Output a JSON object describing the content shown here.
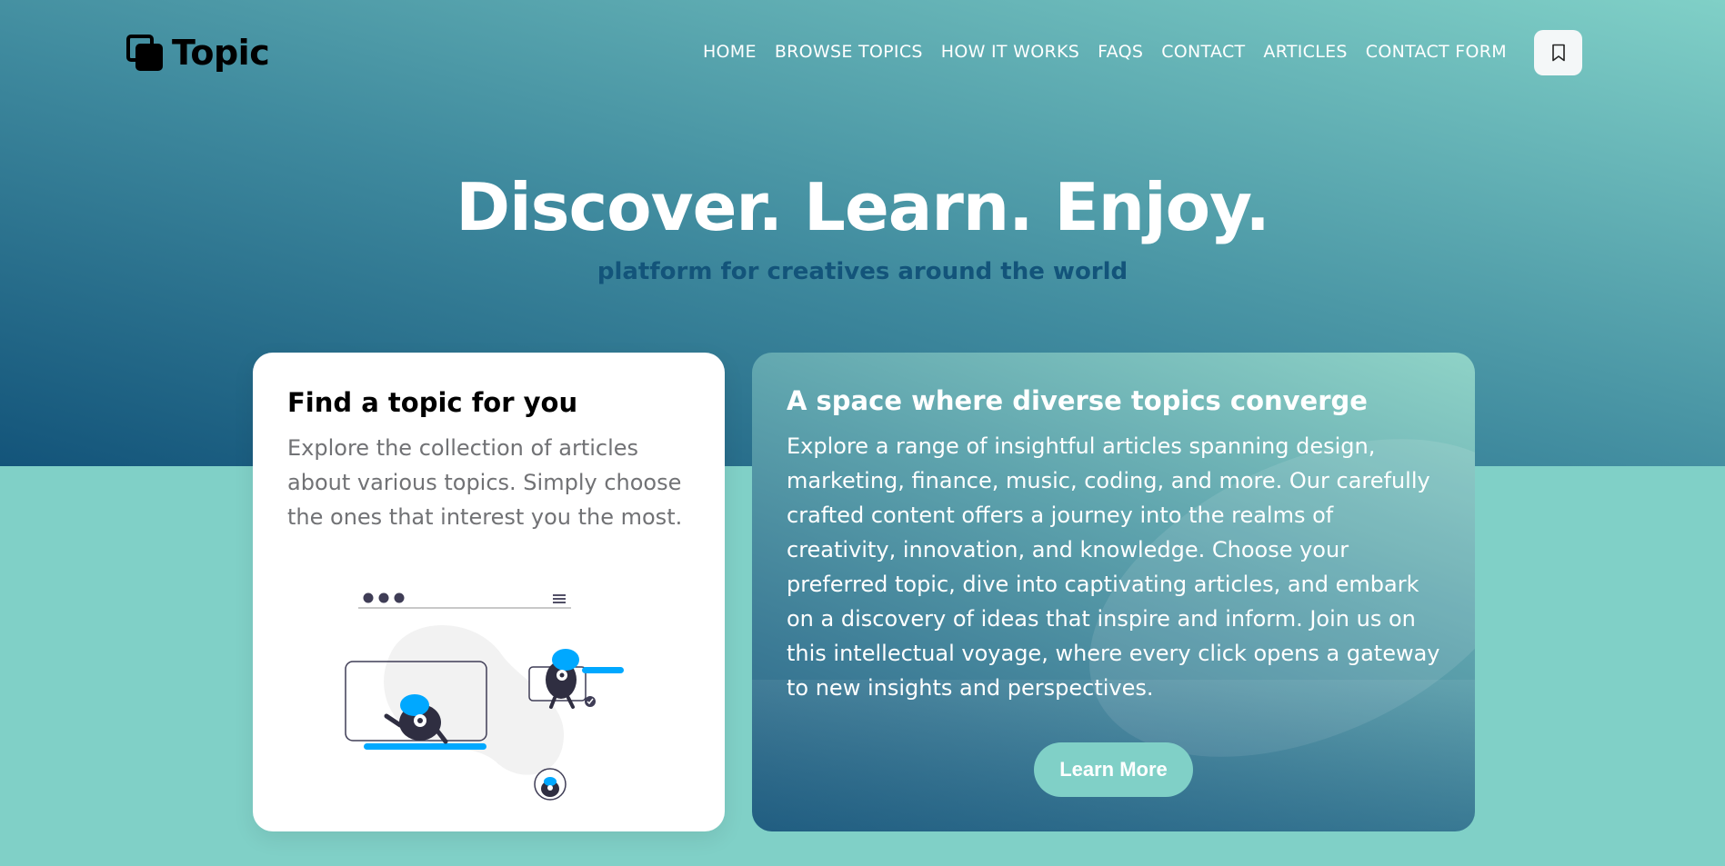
{
  "brand": {
    "name": "Topic"
  },
  "nav": {
    "items": [
      {
        "label": "HOME"
      },
      {
        "label": "BROWSE TOPICS"
      },
      {
        "label": "HOW IT WORKS"
      },
      {
        "label": "FAQS"
      },
      {
        "label": "CONTACT"
      },
      {
        "label": "ARTICLES"
      },
      {
        "label": "CONTACT FORM"
      }
    ],
    "bookmark_icon": "bookmark-icon"
  },
  "hero": {
    "title": "Discover. Learn. Enjoy.",
    "subtitle": "platform for creatives around the world"
  },
  "card_left": {
    "title": "Find a topic for you",
    "text": "Explore the collection of articles about various topics. Simply choose the ones that interest you the most."
  },
  "card_right": {
    "title": "A space where diverse topics converge",
    "text": "Explore a range of insightful articles spanning design, marketing, finance, music, coding, and more. Our carefully crafted content offers a journey into the realms of creativity, innovation, and knowledge. Choose your preferred topic, dive into captivating articles, and embark on a discovery of ideas that inspire and inform. Join us on this intellectual voyage, where every click opens a gateway to new insights and perspectives.",
    "button_label": "Learn More"
  },
  "colors": {
    "primary": "#13547a",
    "secondary": "#80d0c7",
    "accent": "#00a8ff",
    "white": "#ffffff"
  }
}
